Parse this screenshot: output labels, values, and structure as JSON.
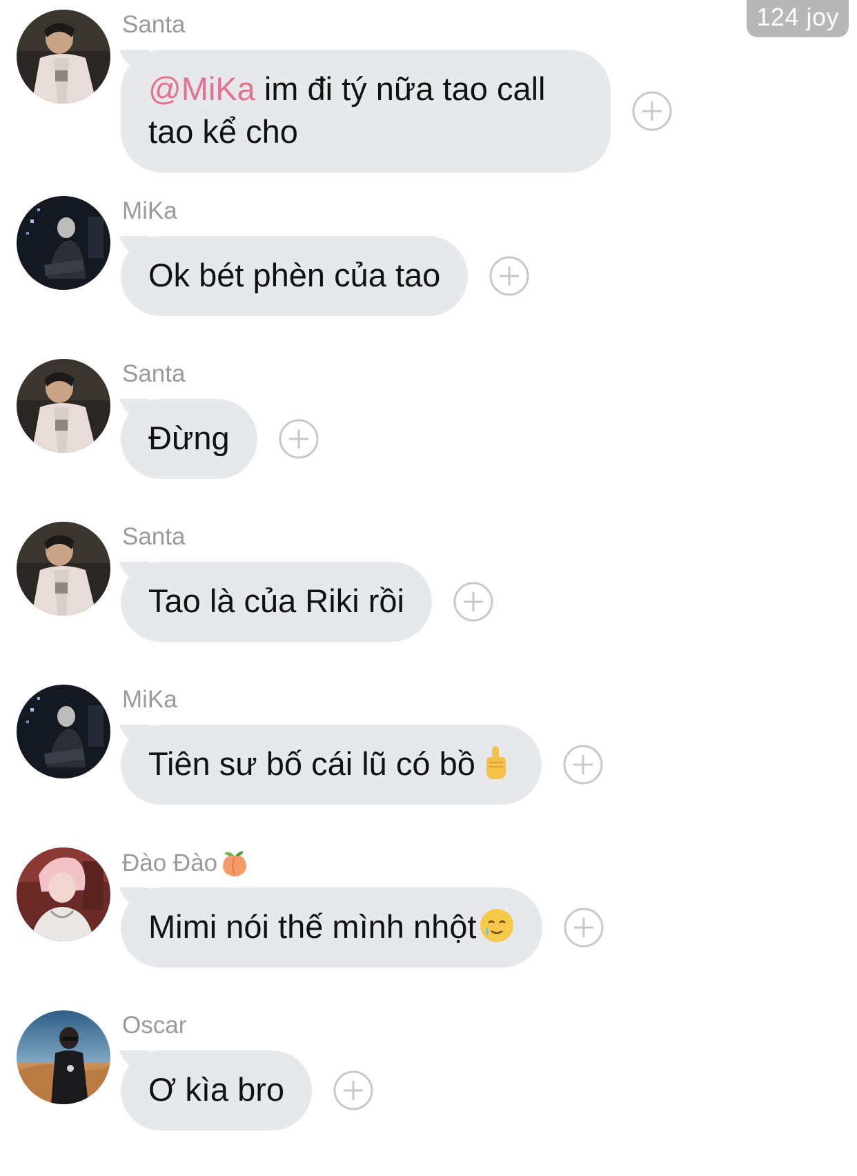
{
  "watermark": "124 joy",
  "messages": [
    {
      "sender": "Santa",
      "mention": "@MiKa",
      "text": " im đi tý nữa tao call tao kể cho",
      "avatar": "santa-avatar"
    },
    {
      "sender": "MiKa",
      "text": "Ok bét phèn của tao",
      "avatar": "mika-avatar"
    },
    {
      "sender": "Santa",
      "text": "Đừng",
      "avatar": "santa-avatar"
    },
    {
      "sender": "Santa",
      "text": "Tao là của Riki rồi",
      "avatar": "santa-avatar"
    },
    {
      "sender": "MiKa",
      "text": "Tiên sư bố cái lũ có bồ",
      "emoji": "middle-finger-emoji",
      "avatar": "mika-avatar"
    },
    {
      "sender": "Đào Đào",
      "sender_emoji": "peach-emoji",
      "text": "Mimi nói thế mình nhột",
      "emoji": "smiling-face-with-tear-emoji",
      "avatar": "daodao-avatar"
    },
    {
      "sender": "Oscar",
      "text": "Ơ kìa bro",
      "avatar": "oscar-avatar"
    }
  ],
  "colors": {
    "bubble": "#e6e8eb",
    "sender": "#9a9a9a",
    "mention": "#e4728f",
    "react_icon": "#c8c8c8",
    "watermark_bg": "#b7b7b7"
  },
  "icons": {
    "reaction": "plus-circle-icon"
  }
}
